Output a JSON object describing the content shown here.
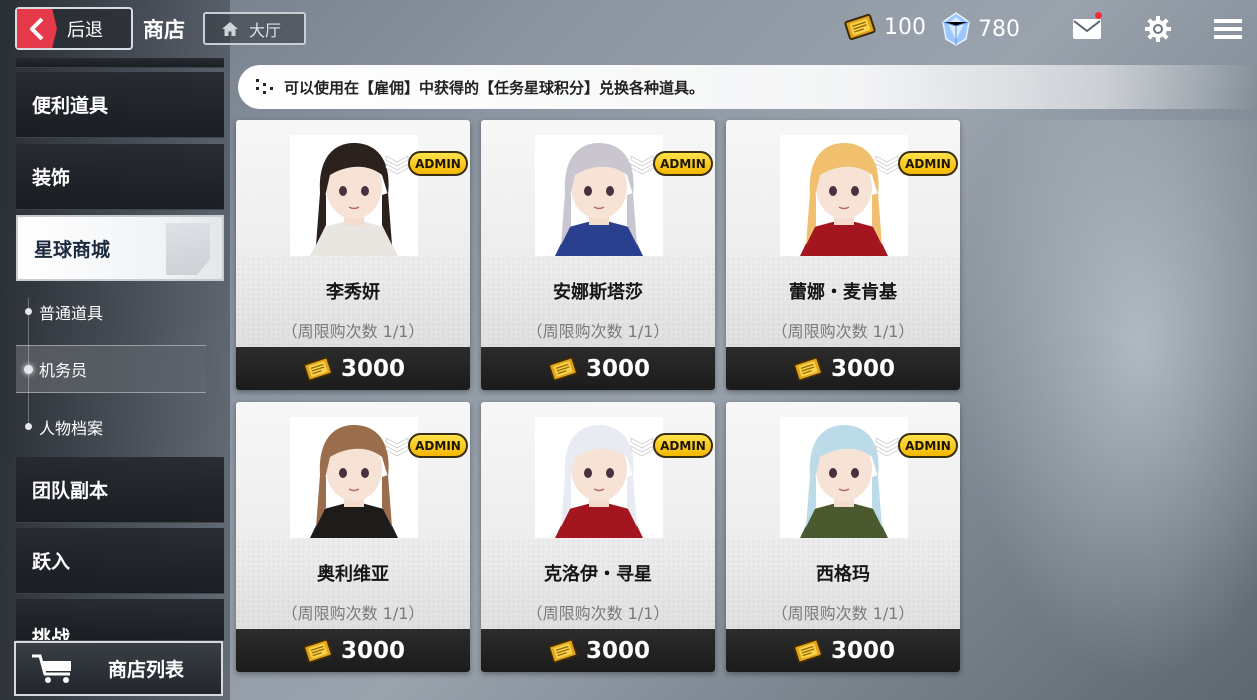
{
  "header": {
    "back_label": "后退",
    "title": "商店",
    "lobby_label": "大厅",
    "gold_amount": "100",
    "gem_amount": "780",
    "mail_unread": true
  },
  "sidebar": {
    "items": [
      {
        "label": "便利道具"
      },
      {
        "label": "装饰"
      },
      {
        "label": "星球商城",
        "active": true
      },
      {
        "label": "团队副本"
      },
      {
        "label": "跃入"
      },
      {
        "label": "挑战"
      }
    ],
    "sub_items": [
      {
        "label": "普通道具"
      },
      {
        "label": "机务员",
        "active": true
      },
      {
        "label": "人物档案"
      }
    ],
    "shop_list_label": "商店列表"
  },
  "notice": {
    "text": "可以使用在【雇佣】中获得的【任务星球积分】兑换各种道具。"
  },
  "products": [
    {
      "name": "李秀妍",
      "limit": "（周限购次数 1/1）",
      "price": "3000",
      "badge": "ADMIN",
      "hair": "#2b211d",
      "accent": "#e9e6e2"
    },
    {
      "name": "安娜斯塔莎",
      "limit": "（周限购次数 1/1）",
      "price": "3000",
      "badge": "ADMIN",
      "hair": "#c9c6cf",
      "accent": "#2b3f8f"
    },
    {
      "name": "蕾娜・麦肯基",
      "limit": "（周限购次数 1/1）",
      "price": "3000",
      "badge": "ADMIN",
      "hair": "#f0c06e",
      "accent": "#a3161f"
    },
    {
      "name": "奥利维亚",
      "limit": "（周限购次数 1/1）",
      "price": "3000",
      "badge": "ADMIN",
      "hair": "#9a6d4c",
      "accent": "#1e1b1b"
    },
    {
      "name": "克洛伊・寻星",
      "limit": "（周限购次数 1/1）",
      "price": "3000",
      "badge": "ADMIN",
      "hair": "#e8ecf2",
      "accent": "#a3161f"
    },
    {
      "name": "西格玛",
      "limit": "（周限购次数 1/1）",
      "price": "3000",
      "badge": "ADMIN",
      "hair": "#bcdbe8",
      "accent": "#4a5a2e"
    }
  ]
}
